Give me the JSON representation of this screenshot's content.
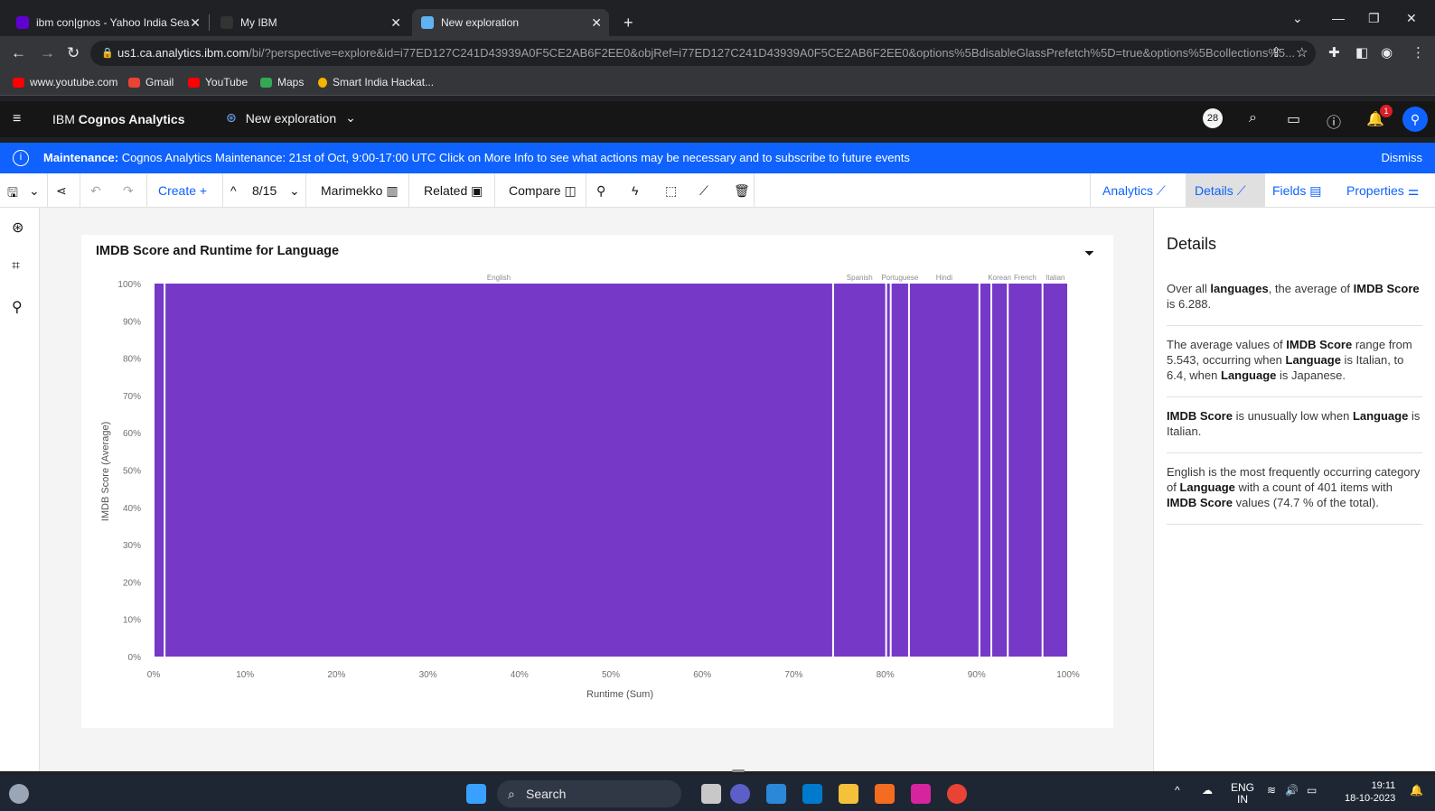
{
  "browser": {
    "tabs": [
      {
        "title": "ibm con|gnos - Yahoo India Sea",
        "favicon_color": "#6001d2"
      },
      {
        "title": "My IBM",
        "favicon_color": "#333333"
      },
      {
        "title": "New exploration",
        "favicon_color": "#5fb3f0"
      }
    ],
    "new_tab": "+",
    "url_host": "us1.ca.analytics.ibm.com",
    "url_path": "/bi/?perspective=explore&id=i77ED127C241D43939A0F5CE2AB6F2EE0&objRef=i77ED127C241D43939A0F5CE2AB6F2EE0&options%5BdisableGlassPrefetch%5D=true&options%5Bcollections%5...",
    "bookmarks": [
      {
        "label": "www.youtube.com",
        "color": "#ff0000"
      },
      {
        "label": "Gmail",
        "color": "#ea4335"
      },
      {
        "label": "YouTube",
        "color": "#ff0000"
      },
      {
        "label": "Maps",
        "color": "#34a853"
      },
      {
        "label": "Smart India Hackat...",
        "color": "#f4b400"
      }
    ]
  },
  "app": {
    "brand_prefix": "IBM ",
    "brand_name": "Cognos Analytics",
    "exploration_name": "New exploration",
    "notification_count": "28",
    "alert_count": "1"
  },
  "banner": {
    "label": "Maintenance:",
    "message": " Cognos Analytics Maintenance: 21st of Oct, 9:00-17:00 UTC Click on More Info to see what actions may be necessary and to subscribe to future events",
    "dismiss": "Dismiss"
  },
  "toolbar": {
    "create": "Create",
    "page_indicator": "8/15",
    "chart_type": "Marimekko",
    "related": "Related",
    "compare": "Compare",
    "analytics": "Analytics",
    "details": "Details",
    "fields": "Fields",
    "properties": "Properties"
  },
  "chart_data": {
    "type": "marimekko",
    "title": "IMDB Score and Runtime for Language",
    "xlabel": "Runtime (Sum)",
    "ylabel": "IMDB Score (Average)",
    "x_ticks": [
      "0%",
      "10%",
      "20%",
      "30%",
      "40%",
      "50%",
      "60%",
      "70%",
      "80%",
      "90%",
      "100%"
    ],
    "y_ticks": [
      "0%",
      "10%",
      "20%",
      "30%",
      "40%",
      "50%",
      "60%",
      "70%",
      "80%",
      "90%",
      "100%"
    ],
    "bar_color": "#7538c7",
    "columns": [
      {
        "label": "",
        "start": 0,
        "end": 1.2
      },
      {
        "label": "English",
        "start": 1.2,
        "end": 74.3
      },
      {
        "label": "Spanish",
        "start": 74.3,
        "end": 80.1
      },
      {
        "label": "",
        "start": 80.1,
        "end": 80.6
      },
      {
        "label": "Portuguese",
        "start": 80.6,
        "end": 82.6
      },
      {
        "label": "Hindi",
        "start": 82.6,
        "end": 90.3
      },
      {
        "label": "",
        "start": 90.3,
        "end": 91.6
      },
      {
        "label": "Korean",
        "start": 91.6,
        "end": 93.4
      },
      {
        "label": "French",
        "start": 93.4,
        "end": 97.2
      },
      {
        "label": "Italian",
        "start": 97.2,
        "end": 100
      }
    ]
  },
  "details_panel": {
    "title": "Details",
    "insights": [
      {
        "parts": [
          [
            "Over all ",
            false
          ],
          [
            "languages",
            true
          ],
          [
            ", the average of ",
            false
          ],
          [
            "IMDB Score",
            true
          ],
          [
            " is 6.288.",
            false
          ]
        ]
      },
      {
        "parts": [
          [
            "The average values of ",
            false
          ],
          [
            "IMDB Score",
            true
          ],
          [
            " range from 5.543, occurring when ",
            false
          ],
          [
            "Language",
            true
          ],
          [
            " is Italian, to 6.4, when ",
            false
          ],
          [
            "Language",
            true
          ],
          [
            " is Japanese.",
            false
          ]
        ]
      },
      {
        "parts": [
          [
            "IMDB Score",
            true
          ],
          [
            " is unusually low when ",
            false
          ],
          [
            "Language",
            true
          ],
          [
            " is Italian.",
            false
          ]
        ]
      },
      {
        "parts": [
          [
            "English is the most frequently occurring category of ",
            false
          ],
          [
            "Language",
            true
          ],
          [
            " with a count of 401 items with ",
            false
          ],
          [
            "IMDB Score",
            true
          ],
          [
            " values (74.7 % of the total).",
            false
          ]
        ]
      }
    ]
  },
  "taskbar": {
    "search": "Search",
    "lang_line1": "ENG",
    "lang_line2": "IN",
    "time": "19:11",
    "date": "18-10-2023"
  }
}
